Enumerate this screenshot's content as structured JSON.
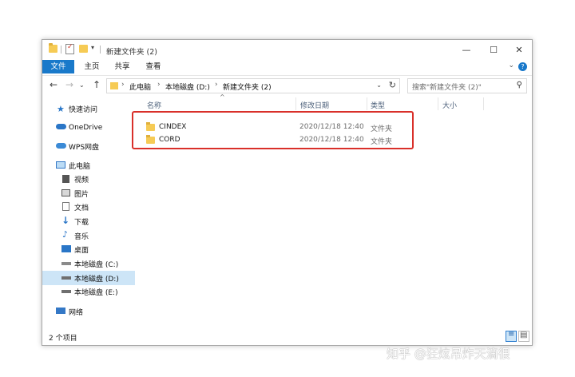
{
  "window": {
    "title": "新建文件夹 (2)"
  },
  "ribbon": {
    "tabs": [
      "文件",
      "主页",
      "共享",
      "查看"
    ]
  },
  "address": {
    "crumbs": [
      "此电脑",
      "本地磁盘 (D:)",
      "新建文件夹 (2)"
    ],
    "search_placeholder": "搜索\"新建文件夹 (2)\""
  },
  "sidebar": {
    "items": [
      {
        "label": "快速访问",
        "icon": "star-icon"
      },
      {
        "label": "OneDrive",
        "icon": "cloud-icon"
      },
      {
        "label": "WPS网盘",
        "icon": "cloud-icon"
      },
      {
        "label": "此电脑",
        "icon": "computer-icon"
      },
      {
        "label": "视频",
        "icon": "video-icon"
      },
      {
        "label": "图片",
        "icon": "picture-icon"
      },
      {
        "label": "文档",
        "icon": "document-icon"
      },
      {
        "label": "下载",
        "icon": "download-icon"
      },
      {
        "label": "音乐",
        "icon": "music-icon"
      },
      {
        "label": "桌面",
        "icon": "desktop-icon"
      },
      {
        "label": "本地磁盘 (C:)",
        "icon": "drive-icon"
      },
      {
        "label": "本地磁盘 (D:)",
        "icon": "drive-icon",
        "selected": true
      },
      {
        "label": "本地磁盘 (E:)",
        "icon": "drive-icon"
      },
      {
        "label": "网络",
        "icon": "network-icon"
      }
    ]
  },
  "columns": {
    "name": "名称",
    "modified": "修改日期",
    "type": "类型",
    "size": "大小"
  },
  "files": [
    {
      "name": "CINDEX",
      "modified": "2020/12/18 12:40",
      "type": "文件夹",
      "size": ""
    },
    {
      "name": "CORD",
      "modified": "2020/12/18 12:40",
      "type": "文件夹",
      "size": ""
    }
  ],
  "status": {
    "item_count": "2 个项目"
  },
  "watermark": "知乎 @狂炫吊炸天滴很",
  "colors": {
    "accent": "#1979ca",
    "selection": "#cde5f7",
    "highlight_box": "#d9302a",
    "folder": "#f6cb55"
  }
}
